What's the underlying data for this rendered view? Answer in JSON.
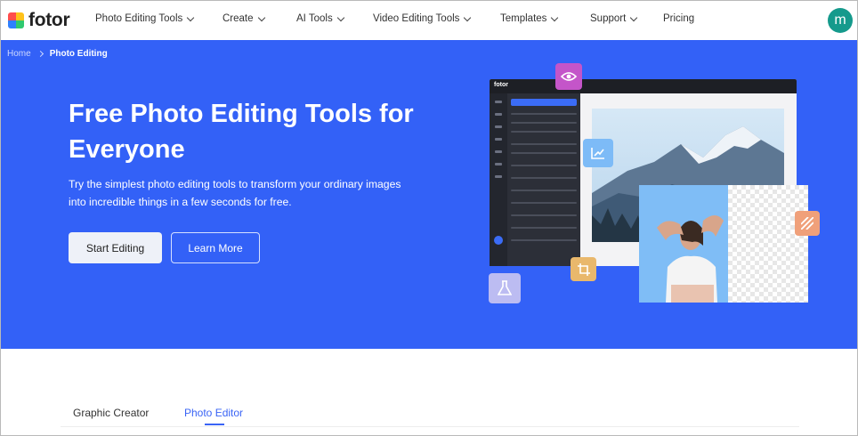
{
  "brand": {
    "name": "fotor"
  },
  "nav": {
    "items": [
      {
        "label": "Photo Editing Tools",
        "has_dropdown": true
      },
      {
        "label": "Create",
        "has_dropdown": true
      },
      {
        "label": "AI Tools",
        "has_dropdown": true
      },
      {
        "label": "Video Editing Tools",
        "has_dropdown": true
      },
      {
        "label": "Templates",
        "has_dropdown": true
      },
      {
        "label": "Support",
        "has_dropdown": true
      },
      {
        "label": "Pricing",
        "has_dropdown": false
      }
    ],
    "avatar_initial": "m"
  },
  "breadcrumb": {
    "home": "Home",
    "current": "Photo Editing"
  },
  "hero": {
    "title": "Free Photo Editing Tools for Everyone",
    "description": "Try the simplest photo editing tools to transform your ordinary images into incredible things in a few seconds for free.",
    "primary_button": "Start Editing",
    "secondary_button": "Learn More",
    "editor_preview_logo": "fotor"
  },
  "tabs": {
    "items": [
      {
        "label": "Graphic Creator",
        "active": false
      },
      {
        "label": "Photo Editor",
        "active": true
      }
    ]
  },
  "colors": {
    "hero_bg": "#3361f7",
    "accent": "#3a64f5",
    "avatar_bg": "#159a8c"
  },
  "icons": [
    "fotor-logo-icon",
    "chevron-down-icon",
    "chevron-right-icon",
    "eye-icon",
    "chart-icon",
    "crop-icon",
    "flask-icon",
    "stripes-icon"
  ]
}
